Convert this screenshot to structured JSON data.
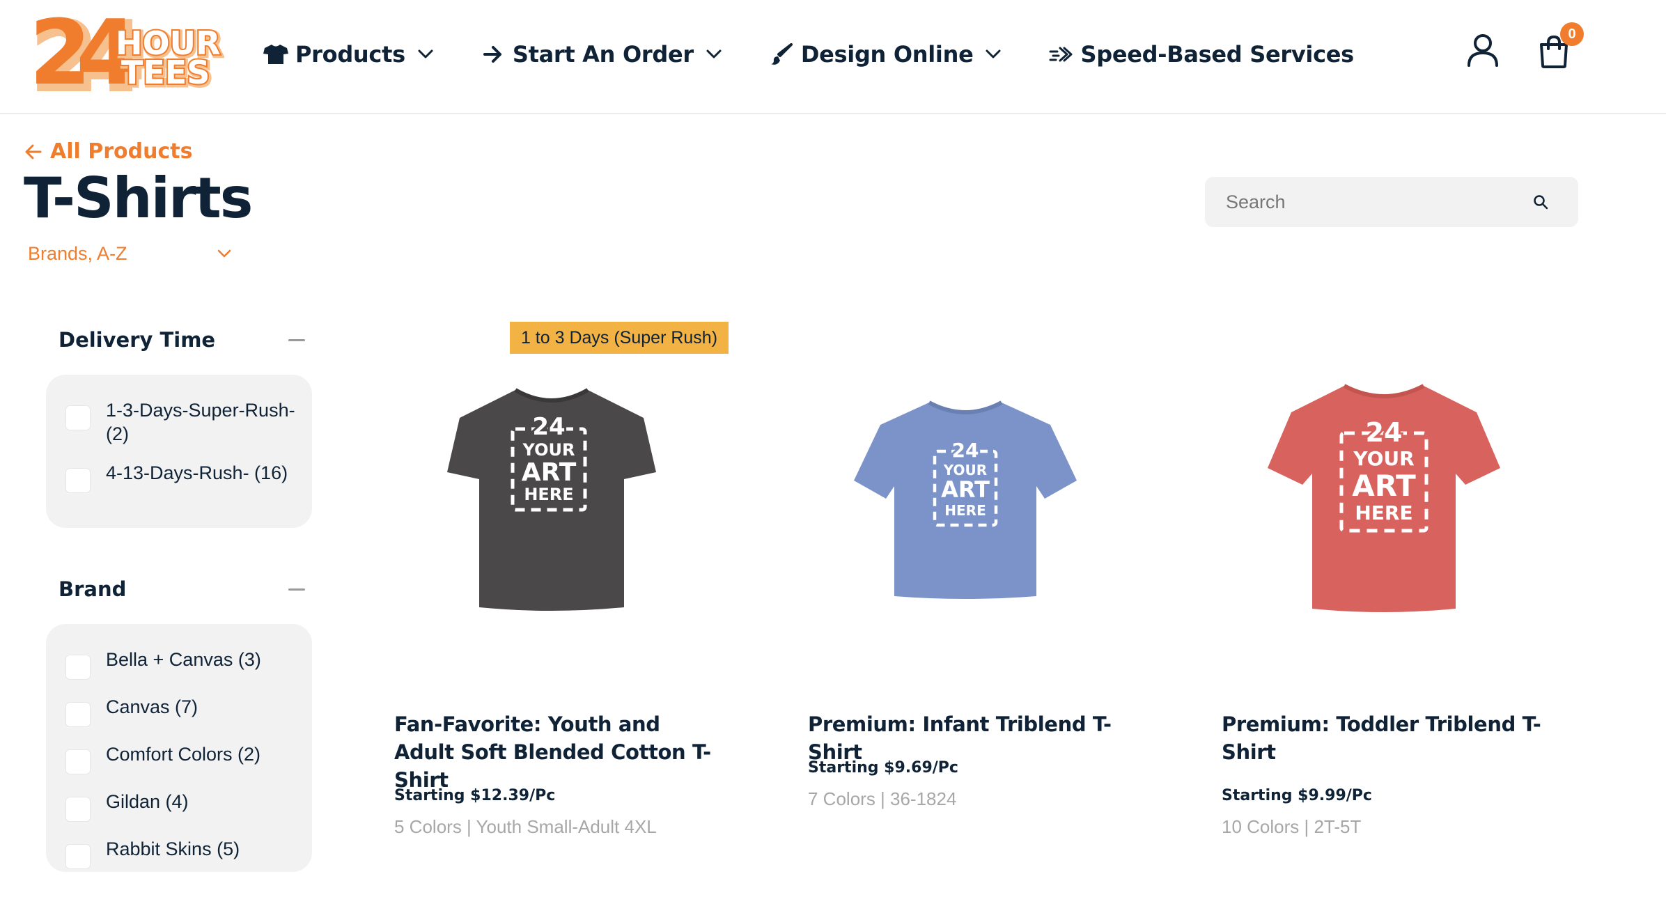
{
  "brand": {
    "logo_number": "24",
    "logo_line1": "HOUR",
    "logo_line2": "TEES",
    "accent": "#ef7d2d",
    "navy": "#0f2236"
  },
  "nav": {
    "items": [
      {
        "label": "Products",
        "icon": "tshirt-icon",
        "has_dropdown": true
      },
      {
        "label": "Start An Order",
        "icon": "arrow-right-icon",
        "has_dropdown": true
      },
      {
        "label": "Design Online",
        "icon": "paintbrush-icon",
        "has_dropdown": true
      },
      {
        "label": "Speed-Based Services",
        "icon": "fast-forward-icon",
        "has_dropdown": false
      }
    ]
  },
  "header": {
    "account_icon": "user-icon",
    "cart_icon": "shopping-bag-icon",
    "cart_count": "0"
  },
  "page": {
    "back_label": "All Products",
    "title": "T-Shirts",
    "sort_value": "Brands, A-Z"
  },
  "search": {
    "placeholder": "Search",
    "value": ""
  },
  "filters": [
    {
      "title": "Delivery Time",
      "options": [
        {
          "label": "1-3-Days-Super-Rush- (2)",
          "checked": false
        },
        {
          "label": "4-13-Days-Rush- (16)",
          "checked": false
        }
      ]
    },
    {
      "title": "Brand",
      "options": [
        {
          "label": "Bella + Canvas (3)",
          "checked": false
        },
        {
          "label": "Canvas (7)",
          "checked": false
        },
        {
          "label": "Comfort Colors (2)",
          "checked": false
        },
        {
          "label": "Gildan (4)",
          "checked": false
        },
        {
          "label": "Rabbit Skins (5)",
          "checked": false
        }
      ]
    }
  ],
  "products": [
    {
      "badge": "1 to 3 Days (Super Rush)",
      "title": "Fan-Favorite: Youth and Adult Soft Blended Cotton T-Shirt",
      "price": "Starting $12.39/Pc",
      "meta": "5 Colors | Youth Small-Adult 4XL",
      "shirt_color": "#4a4848",
      "art_text": [
        "YOUR",
        "ART",
        "HERE"
      ],
      "art_logo": "24"
    },
    {
      "badge": "",
      "title": "Premium: Infant Triblend T-Shirt",
      "price": "Starting $9.69/Pc",
      "meta": "7 Colors | 36-1824",
      "shirt_color": "#7b93c8",
      "art_text": [
        "YOUR",
        "ART",
        "HERE"
      ],
      "art_logo": "24"
    },
    {
      "badge": "",
      "title": "Premium: Toddler Triblend T-Shirt",
      "price": "Starting $9.99/Pc",
      "meta": "10 Colors | 2T-5T",
      "shirt_color": "#d7625e",
      "art_text": [
        "YOUR",
        "ART",
        "HERE"
      ],
      "art_logo": "24"
    }
  ]
}
